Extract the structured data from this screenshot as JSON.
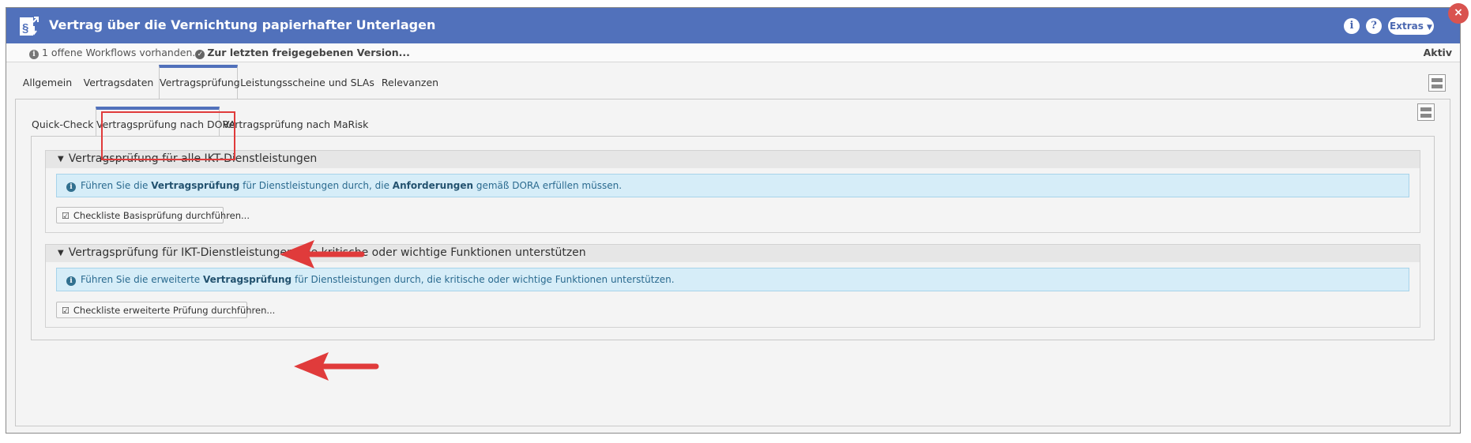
{
  "window": {
    "title": "Vertrag über die Vernichtung papierhafter Unterlagen",
    "app_icon": "contract-document-icon",
    "info_button": "i",
    "help_button": "?",
    "extras_label": "Extras",
    "close_label": "×"
  },
  "status": {
    "workflows_text": "1 offene Workflows vorhanden.",
    "version_link": "Zur letzten freigegebenen Version...",
    "state": "Aktiv"
  },
  "main_tabs": [
    {
      "label": "Allgemein"
    },
    {
      "label": "Vertragsdaten"
    },
    {
      "label": "Vertragsprüfung",
      "active": true
    },
    {
      "label": "Leistungsscheine und SLAs"
    },
    {
      "label": "Relevanzen"
    }
  ],
  "sub_tabs": [
    {
      "label": "Quick-Check"
    },
    {
      "label": "Vertragsprüfung nach DORA",
      "active": true
    },
    {
      "label": "Vertragsprüfung nach MaRisk"
    }
  ],
  "sections": [
    {
      "title": "Vertragsprüfung für alle IKT-Dienstleistungen",
      "info": {
        "t1": "Führen Sie die ",
        "b1": "Vertragsprüfung",
        "t2": " für Dienstleistungen durch, die ",
        "b2": "Anforderungen",
        "t3": " gemäß DORA erfüllen müssen."
      },
      "button": "Checkliste Basisprüfung durchführen..."
    },
    {
      "title": "Vertragsprüfung für IKT-Dienstleistungen, die kritische oder wichtige Funktionen unterstützen",
      "info": {
        "t1": "Führen Sie die erweiterte ",
        "b1": "Vertragsprüfung",
        "t2": " für Dienstleistungen durch, die kritische oder wichtige Funktionen unterstützen."
      },
      "button": "Checkliste erweiterte Prüfung durchführen..."
    }
  ],
  "colors": {
    "title_bar": "#5171bb",
    "annotation_red": "#e03b3b",
    "info_bg": "#d6edf8"
  }
}
